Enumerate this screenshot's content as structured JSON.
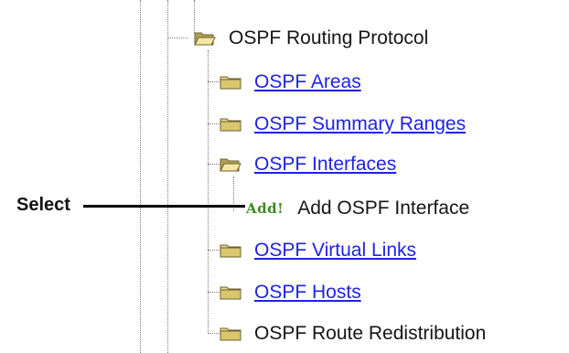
{
  "callout": {
    "label": "Select"
  },
  "tree": {
    "parent": {
      "label": "OSPF Routing Protocol",
      "icon": "open-folder-icon"
    },
    "items": [
      {
        "label": "OSPF Areas",
        "icon": "folder-icon",
        "is_link": true
      },
      {
        "label": "OSPF Summary Ranges",
        "icon": "folder-icon",
        "is_link": true
      },
      {
        "label": "OSPF Interfaces",
        "icon": "open-folder-icon",
        "is_link": true
      },
      {
        "label": "OSPF Virtual Links",
        "icon": "folder-icon",
        "is_link": true
      },
      {
        "label": "OSPF Hosts",
        "icon": "folder-icon",
        "is_link": true
      },
      {
        "label": "OSPF Route Redistribution",
        "icon": "folder-icon",
        "is_link": false
      }
    ],
    "child": {
      "badge": "Add!",
      "label": "Add OSPF Interface"
    }
  },
  "colors": {
    "link": "#1f22e6",
    "badge": "#3d8a22",
    "folder_fill": "#e8d88a",
    "folder_dark": "#b3a052",
    "tree_line": "#7a7a7a"
  }
}
